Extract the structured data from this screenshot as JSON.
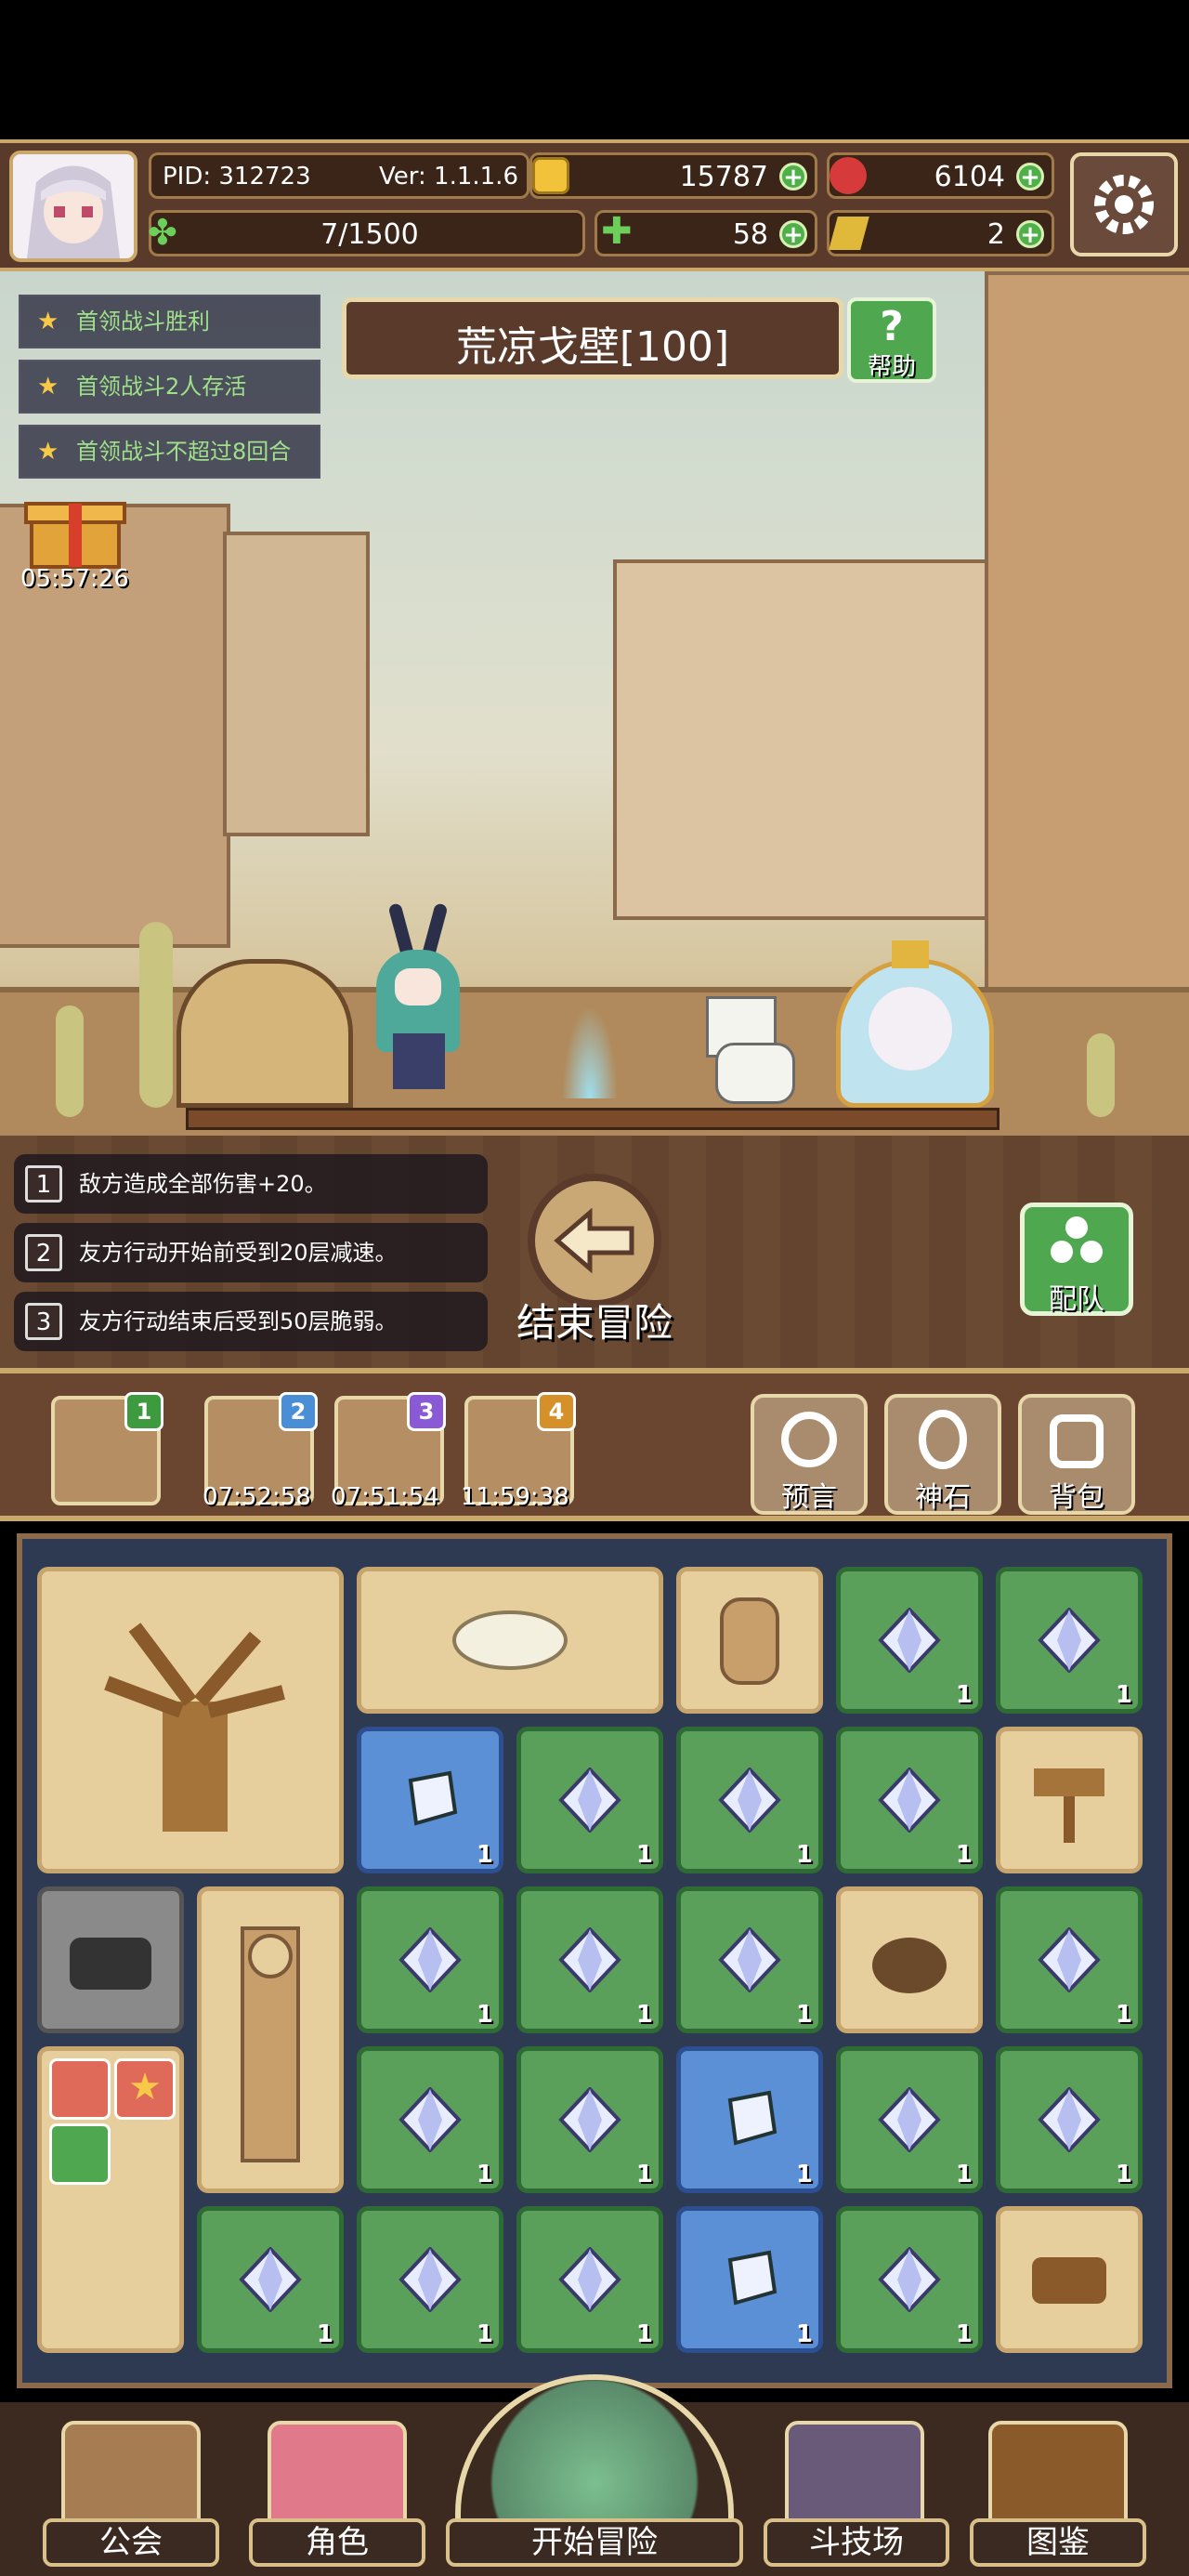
{
  "header": {
    "pid": "PID: 312723",
    "version": "Ver: 1.1.1.6",
    "gold": "15787",
    "ruby": "6104",
    "stamina": "7/1500",
    "clover": "58",
    "ticket": "2"
  },
  "quests": [
    "首领战斗胜利",
    "首领战斗2人存活",
    "首领战斗不超过8回合"
  ],
  "gift_timer": "05:57:26",
  "stage": {
    "title": "荒凉戈壁[100]",
    "help_label": "帮助"
  },
  "buffs": [
    {
      "num": "1",
      "text": "敌方造成全部伤害+20。"
    },
    {
      "num": "2",
      "text": "友方行动开始前受到20层减速。"
    },
    {
      "num": "3",
      "text": "友方行动结束后受到50层脆弱。"
    }
  ],
  "end_label": "结束冒险",
  "team_label": "配队",
  "maps": [
    {
      "num": "1",
      "timer": "",
      "color": "#3e9a3e"
    },
    {
      "num": "2",
      "timer": "07:52:58",
      "color": "#4a8fd6"
    },
    {
      "num": "3",
      "timer": "07:51:54",
      "color": "#8a5ad6"
    },
    {
      "num": "4",
      "timer": "11:59:38",
      "color": "#d6902a"
    }
  ],
  "tools": [
    "预言",
    "神石",
    "背包"
  ],
  "grid_count": "1",
  "nav": [
    "公会",
    "角色",
    "开始冒险",
    "斗技场",
    "图鉴"
  ]
}
